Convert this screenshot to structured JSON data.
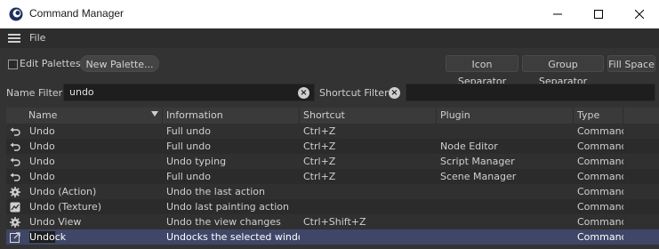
{
  "window": {
    "title": "Command Manager"
  },
  "menu": {
    "file": "File"
  },
  "toolbar": {
    "edit_palettes": "Edit Palettes",
    "new_palette": "New Palette...",
    "icon_separator": "Icon Separator",
    "group_separator": "Group Separator",
    "fill_space": "Fill Space"
  },
  "filters": {
    "name_label": "Name Filter",
    "name_value": "undo",
    "shortcut_label": "Shortcut Filter",
    "shortcut_value": ""
  },
  "table": {
    "columns": [
      "Name",
      "Information",
      "Shortcut",
      "Plugin",
      "Type"
    ],
    "rows": [
      {
        "icon": "undo-arrow-icon",
        "name": "Undo",
        "info": "Full undo",
        "shortcut": "Ctrl+Z",
        "plugin": "",
        "type": "Command"
      },
      {
        "icon": "undo-arrow-icon",
        "name": "Undo",
        "info": "Full undo",
        "shortcut": "Ctrl+Z",
        "plugin": "Node Editor",
        "type": "Command"
      },
      {
        "icon": "undo-arrow-icon",
        "name": "Undo",
        "info": "Undo typing",
        "shortcut": "Ctrl+Z",
        "plugin": "Script Manager",
        "type": "Command"
      },
      {
        "icon": "undo-arrow-icon",
        "name": "Undo",
        "info": "Full undo",
        "shortcut": "Ctrl+Z",
        "plugin": "Scene Manager",
        "type": "Command"
      },
      {
        "icon": "gear-icon",
        "name": "Undo (Action)",
        "info": "Undo the last action",
        "shortcut": "",
        "plugin": "",
        "type": "Command"
      },
      {
        "icon": "texture-icon",
        "name": "Undo (Texture)",
        "info": "Undo last painting action",
        "shortcut": "",
        "plugin": "",
        "type": "Command"
      },
      {
        "icon": "gear-icon",
        "name": "Undo View",
        "info": "Undo the view changes",
        "shortcut": "Ctrl+Shift+Z",
        "plugin": "",
        "type": "Command"
      },
      {
        "icon": "undock-icon",
        "name_pre": "Undo",
        "name_post": "ck",
        "info": "Undocks the selected window",
        "shortcut": "",
        "plugin": "",
        "type": "Command",
        "selected": true
      }
    ]
  }
}
